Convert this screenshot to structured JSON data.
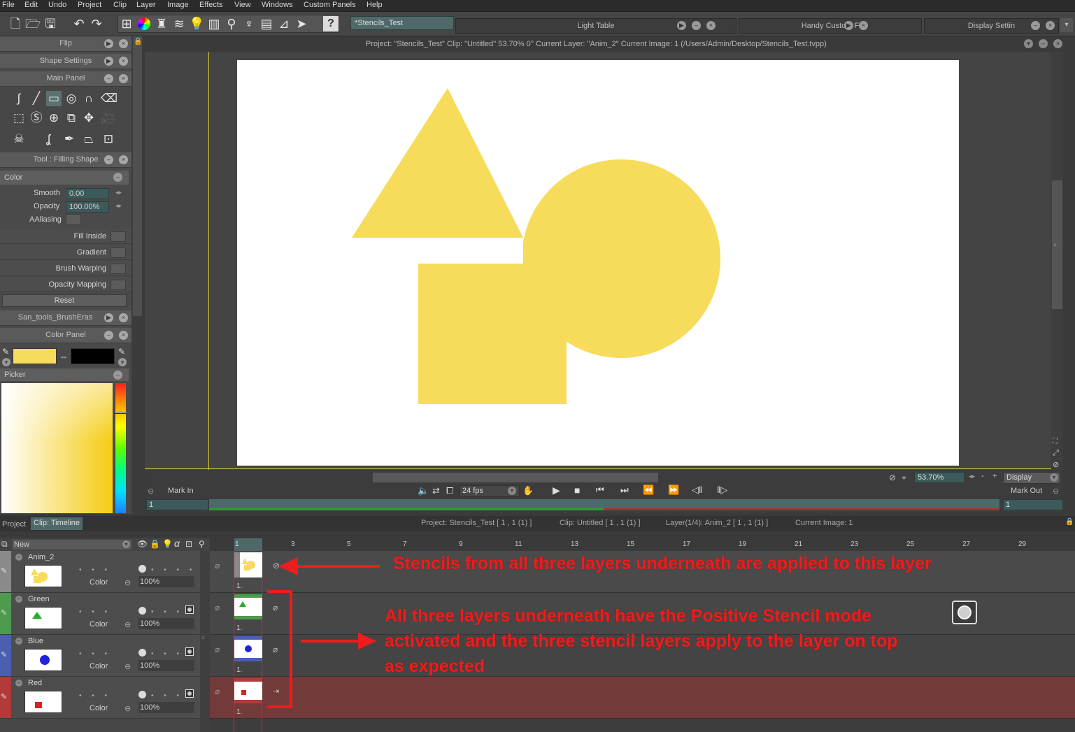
{
  "menu": [
    "File",
    "Edit",
    "Undo",
    "Project",
    "Clip",
    "Layer",
    "Image",
    "Effects",
    "View",
    "Windows",
    "Custom Panels",
    "Help"
  ],
  "tabs": {
    "active_doc": "*Stencils_Test",
    "light_table": "Light Table",
    "handy": "Handy Custom F",
    "display": "Display Settin"
  },
  "infobar": "Project:  \"Stencils_Test\"  Clip: \"Untitled\"   53.70%   0°  Current Layer: \"Anim_2\"  Current Image: 1 (/Users/Admin/Desktop/Stencils_Test.tvpp)",
  "panels": {
    "flip": "Flip",
    "shape_settings": "Shape Settings",
    "main_panel": "Main Panel",
    "tool": "Tool : Filling Shape",
    "color_section": "Color",
    "smooth_label": "Smooth",
    "smooth_value": "0.00",
    "opacity_label": "Opacity",
    "opacity_value": "100.00%",
    "aaliasing": "AAliasing",
    "fill_inside": "Fill Inside",
    "gradient": "Gradient",
    "brush_warping": "Brush Warping",
    "opacity_mapping": "Opacity Mapping",
    "reset": "Reset",
    "san_tools": "San_tools_BrushEras",
    "color_panel": "Color Panel",
    "picker": "Picker",
    "primary_color": "#f6dc5a",
    "secondary_color": "#000000"
  },
  "playbar": {
    "mark_in": "Mark In",
    "mark_out": "Mark Out",
    "fps": "24 fps",
    "zoom": "53.70%",
    "display": "Display",
    "start": "1",
    "end": "1"
  },
  "timeline": {
    "project_tab": "Project",
    "clip_tab": "Clip: Timeline",
    "info_project": "Project: Stencils_Test [ 1 , 1  (1) ]",
    "info_clip": "Clip: Untitled [ 1 , 1  (1) ]",
    "info_layer": "Layer(1/4): Anim_2 [ 1 , 1  (1) ]",
    "info_image": "Current Image: 1",
    "new_label": "New",
    "frame_numbers": [
      "1",
      "3",
      "5",
      "7",
      "9",
      "11",
      "13",
      "15",
      "17",
      "19",
      "21",
      "23",
      "25",
      "27",
      "29"
    ],
    "layers": [
      {
        "name": "Anim_2",
        "mode": "Color",
        "opacity": "100%",
        "color": "#606060",
        "frame": "1."
      },
      {
        "name": "Green",
        "mode": "Color",
        "opacity": "100%",
        "color": "#4e9a4e",
        "frame": "1."
      },
      {
        "name": "Blue",
        "mode": "Color",
        "opacity": "100%",
        "color": "#4a5fb0",
        "frame": "1."
      },
      {
        "name": "Red",
        "mode": "Color",
        "opacity": "100%",
        "color": "#b23a3a",
        "frame": "1."
      }
    ]
  },
  "annotations": {
    "top": "Stencils from all three layers underneath are applied to this layer",
    "line1": "All three layers underneath have the Positive Stencil mode",
    "line2": "activated and the three stencil layers apply to the layer on top",
    "line3": "as expected"
  },
  "shape_color": "#f6dc5a"
}
